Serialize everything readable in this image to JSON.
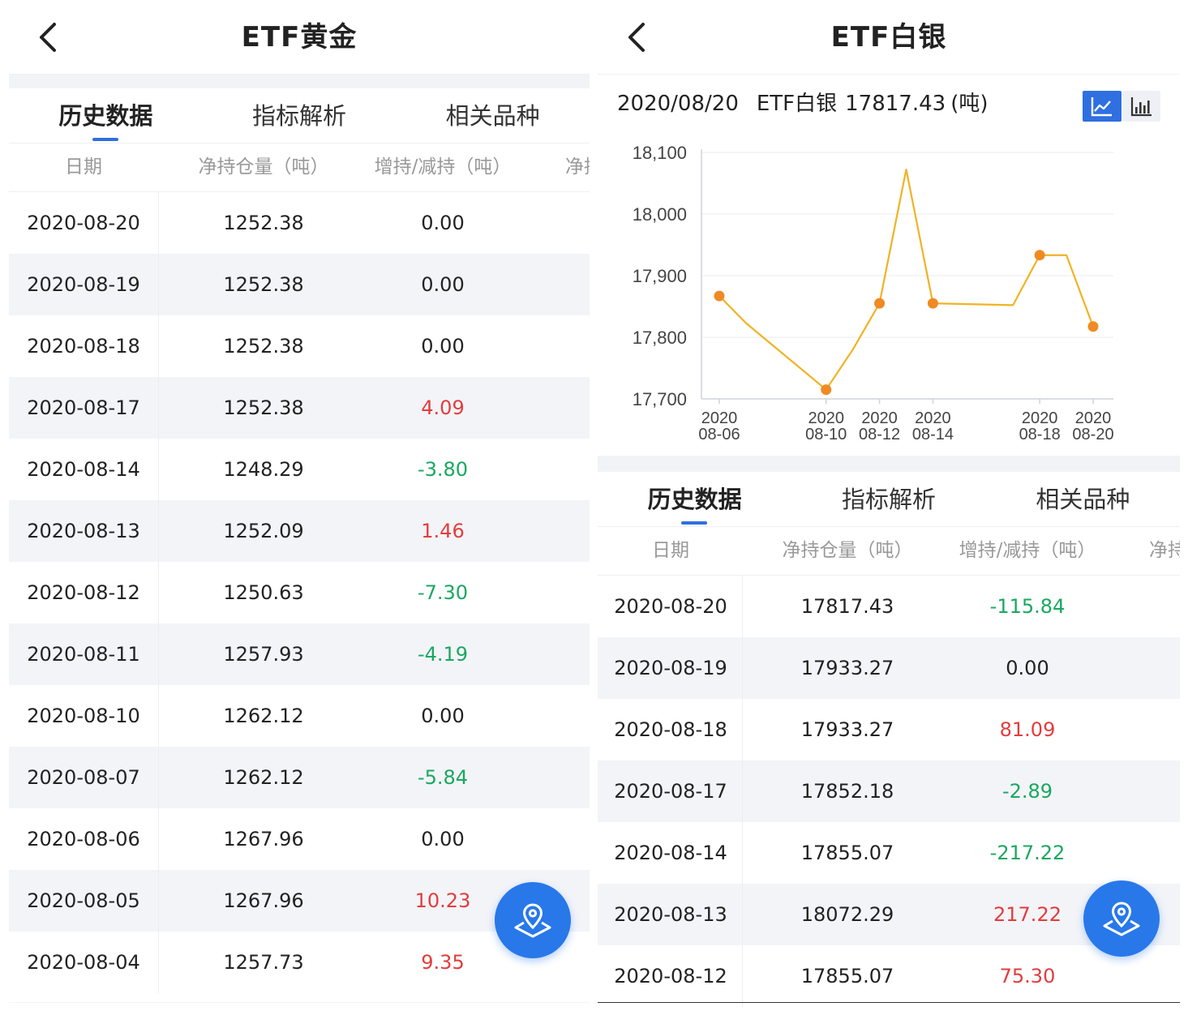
{
  "gold": {
    "title": "ETF黄金",
    "tabs": [
      "历史数据",
      "指标解析",
      "相关品种"
    ],
    "columns": [
      "日期",
      "净持仓量（吨）",
      "增持/减持（吨）",
      "净持"
    ],
    "rows": [
      {
        "date": "2020-08-20",
        "holding": "1252.38",
        "change": "0.00",
        "dir": "flat"
      },
      {
        "date": "2020-08-19",
        "holding": "1252.38",
        "change": "0.00",
        "dir": "flat"
      },
      {
        "date": "2020-08-18",
        "holding": "1252.38",
        "change": "0.00",
        "dir": "flat"
      },
      {
        "date": "2020-08-17",
        "holding": "1252.38",
        "change": "4.09",
        "dir": "up"
      },
      {
        "date": "2020-08-14",
        "holding": "1248.29",
        "change": "-3.80",
        "dir": "down"
      },
      {
        "date": "2020-08-13",
        "holding": "1252.09",
        "change": "1.46",
        "dir": "up"
      },
      {
        "date": "2020-08-12",
        "holding": "1250.63",
        "change": "-7.30",
        "dir": "down"
      },
      {
        "date": "2020-08-11",
        "holding": "1257.93",
        "change": "-4.19",
        "dir": "down"
      },
      {
        "date": "2020-08-10",
        "holding": "1262.12",
        "change": "0.00",
        "dir": "flat"
      },
      {
        "date": "2020-08-07",
        "holding": "1262.12",
        "change": "-5.84",
        "dir": "down"
      },
      {
        "date": "2020-08-06",
        "holding": "1267.96",
        "change": "0.00",
        "dir": "flat"
      },
      {
        "date": "2020-08-05",
        "holding": "1267.96",
        "change": "10.23",
        "dir": "up"
      },
      {
        "date": "2020-08-04",
        "holding": "1257.73",
        "change": "9.35",
        "dir": "up"
      }
    ]
  },
  "silver": {
    "title": "ETF白银",
    "caption": {
      "date": "2020/08/20",
      "name": "ETF白银",
      "value": "17817.43",
      "unit": "(吨)"
    },
    "tabs": [
      "历史数据",
      "指标解析",
      "相关品种"
    ],
    "columns": [
      "日期",
      "净持仓量（吨）",
      "增持/减持（吨）",
      "净持"
    ],
    "rows": [
      {
        "date": "2020-08-20",
        "holding": "17817.43",
        "change": "-115.84",
        "dir": "down"
      },
      {
        "date": "2020-08-19",
        "holding": "17933.27",
        "change": "0.00",
        "dir": "flat"
      },
      {
        "date": "2020-08-18",
        "holding": "17933.27",
        "change": "81.09",
        "dir": "up"
      },
      {
        "date": "2020-08-17",
        "holding": "17852.18",
        "change": "-2.89",
        "dir": "down"
      },
      {
        "date": "2020-08-14",
        "holding": "17855.07",
        "change": "-217.22",
        "dir": "down"
      },
      {
        "date": "2020-08-13",
        "holding": "18072.29",
        "change": "217.22",
        "dir": "up"
      },
      {
        "date": "2020-08-12",
        "holding": "17855.07",
        "change": "75.30",
        "dir": "up"
      }
    ]
  },
  "colors": {
    "accent": "#2f6fe0",
    "up": "#e23d3d",
    "down": "#1aa860",
    "line": "#f0b323",
    "marker": "#f08a24"
  },
  "chart_data": {
    "type": "line",
    "title": "",
    "xlabel": "",
    "ylabel": "",
    "ylim": [
      17700,
      18100
    ],
    "yticks": [
      "17,700",
      "17,800",
      "17,900",
      "18,000",
      "18,100"
    ],
    "x": [
      "2020-08-06",
      "2020-08-07",
      "2020-08-10",
      "2020-08-11",
      "2020-08-12",
      "2020-08-13",
      "2020-08-14",
      "2020-08-17",
      "2020-08-18",
      "2020-08-19",
      "2020-08-20"
    ],
    "xticks": [
      [
        "2020",
        "08-06"
      ],
      [
        "2020",
        "08-10"
      ],
      [
        "2020",
        "08-12"
      ],
      [
        "2020",
        "08-14"
      ],
      [
        "2020",
        "08-18"
      ],
      [
        "2020",
        "08-20"
      ]
    ],
    "series": [
      {
        "values": [
          17867,
          17823,
          17715,
          17780,
          17855.07,
          18072.29,
          17855.07,
          17852.18,
          17933.27,
          17933.27,
          17817.43
        ]
      }
    ],
    "markers_at": [
      "2020-08-06",
      "2020-08-10",
      "2020-08-12",
      "2020-08-14",
      "2020-08-18",
      "2020-08-20"
    ],
    "grid": true
  }
}
